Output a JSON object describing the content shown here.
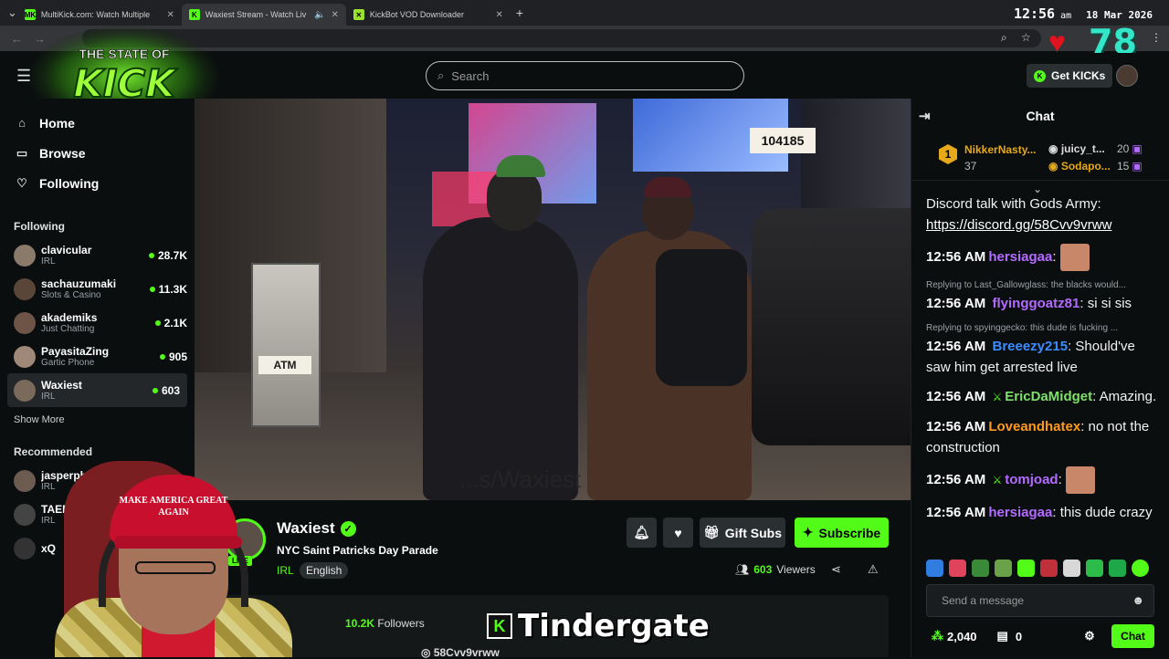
{
  "browser": {
    "tabs": [
      {
        "fav": "MK",
        "title": "MultiKick.com: Watch Multiple"
      },
      {
        "fav": "K",
        "title": "Waxiest Stream - Watch Liv"
      },
      {
        "fav": "✕",
        "title": "KickBot VOD Downloader"
      }
    ]
  },
  "overlay": {
    "time": "12:56",
    "ampm": "am",
    "date": "18 Mar 2026",
    "heart_count": "78",
    "logo_top": "THE STATE OF",
    "logo_main": "KICK",
    "caption": "Tindergate",
    "hat_text": "MAKE AMERICA GREAT AGAIN"
  },
  "header": {
    "search_placeholder": "Search",
    "get_kicks": "Get KICKs"
  },
  "sidebar": {
    "nav": [
      {
        "label": "Home",
        "icon": "home-icon"
      },
      {
        "label": "Browse",
        "icon": "browse-icon"
      },
      {
        "label": "Following",
        "icon": "heart-icon"
      }
    ],
    "following_title": "Following",
    "following": [
      {
        "name": "clavicular",
        "category": "IRL",
        "viewers": "28.7K"
      },
      {
        "name": "sachauzumaki",
        "category": "Slots & Casino",
        "viewers": "11.3K"
      },
      {
        "name": "akademiks",
        "category": "Just Chatting",
        "viewers": "2.1K"
      },
      {
        "name": "PayasitaZing",
        "category": "Gartic Phone",
        "viewers": "905"
      },
      {
        "name": "Waxiest",
        "category": "IRL",
        "viewers": "603"
      }
    ],
    "show_more": "Show More",
    "recommended_title": "Recommended",
    "recommended": [
      {
        "name": "jasperphir",
        "category": "IRL"
      },
      {
        "name": "TAEMIN",
        "category": "IRL"
      },
      {
        "name": "xQ",
        "category": ""
      }
    ]
  },
  "video": {
    "sign_text": "104185",
    "atm_label": "ATM",
    "watermark": "...s/Waxiest"
  },
  "stream": {
    "name": "Waxiest",
    "title": "NYC Saint Patricks Day Parade",
    "category": "IRL",
    "language": "English",
    "live_badge": "LIVE",
    "gift_subs": "Gift Subs",
    "subscribe": "Subscribe",
    "viewers_count": "603",
    "viewers_label": "Viewers",
    "followers_count": "10.2K",
    "followers_label": "Followers",
    "discord": "58Cvv9vrww"
  },
  "chat": {
    "title": "Chat",
    "leaders": [
      {
        "name": "NikkerNasty...",
        "count": "37",
        "rank": "1"
      },
      {
        "name": "juicy_t...",
        "count": "20"
      },
      {
        "name": "Sodapo...",
        "count": "15"
      }
    ],
    "pinned_text": "Discord talk with Gods Army:",
    "pinned_link": "https://discord.gg/58Cvv9vrww",
    "messages": [
      {
        "time": "12:56 AM",
        "user": "hersiagaa",
        "color": "#b36bff",
        "text": ""
      },
      {
        "reply": "Replying to Last_Gallowglass: the blacks would...",
        "time": "12:56 AM",
        "user": "flyinggoatz81",
        "color": "#b36bff",
        "text": "si si sis"
      },
      {
        "reply": "Replying to spyinggecko: this dude is fucking ...",
        "time": "12:56 AM",
        "user": "Breeezy215",
        "color": "#3b8cff",
        "text": "Should've saw him get arrested live"
      },
      {
        "time": "12:56 AM",
        "user": "EricDaMidget",
        "color": "#7ee06a",
        "text": "Amazing."
      },
      {
        "time": "12:56 AM",
        "user": "Loveandhatex",
        "color": "#ff9a1f",
        "text": "no not the construction"
      },
      {
        "time": "12:56 AM",
        "user": "tomjoad",
        "color": "#b36bff",
        "text": ""
      },
      {
        "time": "12:56 AM",
        "user": "hersiagaa",
        "color": "#b36bff",
        "text": "this dude crazy"
      }
    ],
    "send_placeholder": "Send a message",
    "points": "2,040",
    "drops": "0",
    "chat_button": "Chat"
  }
}
